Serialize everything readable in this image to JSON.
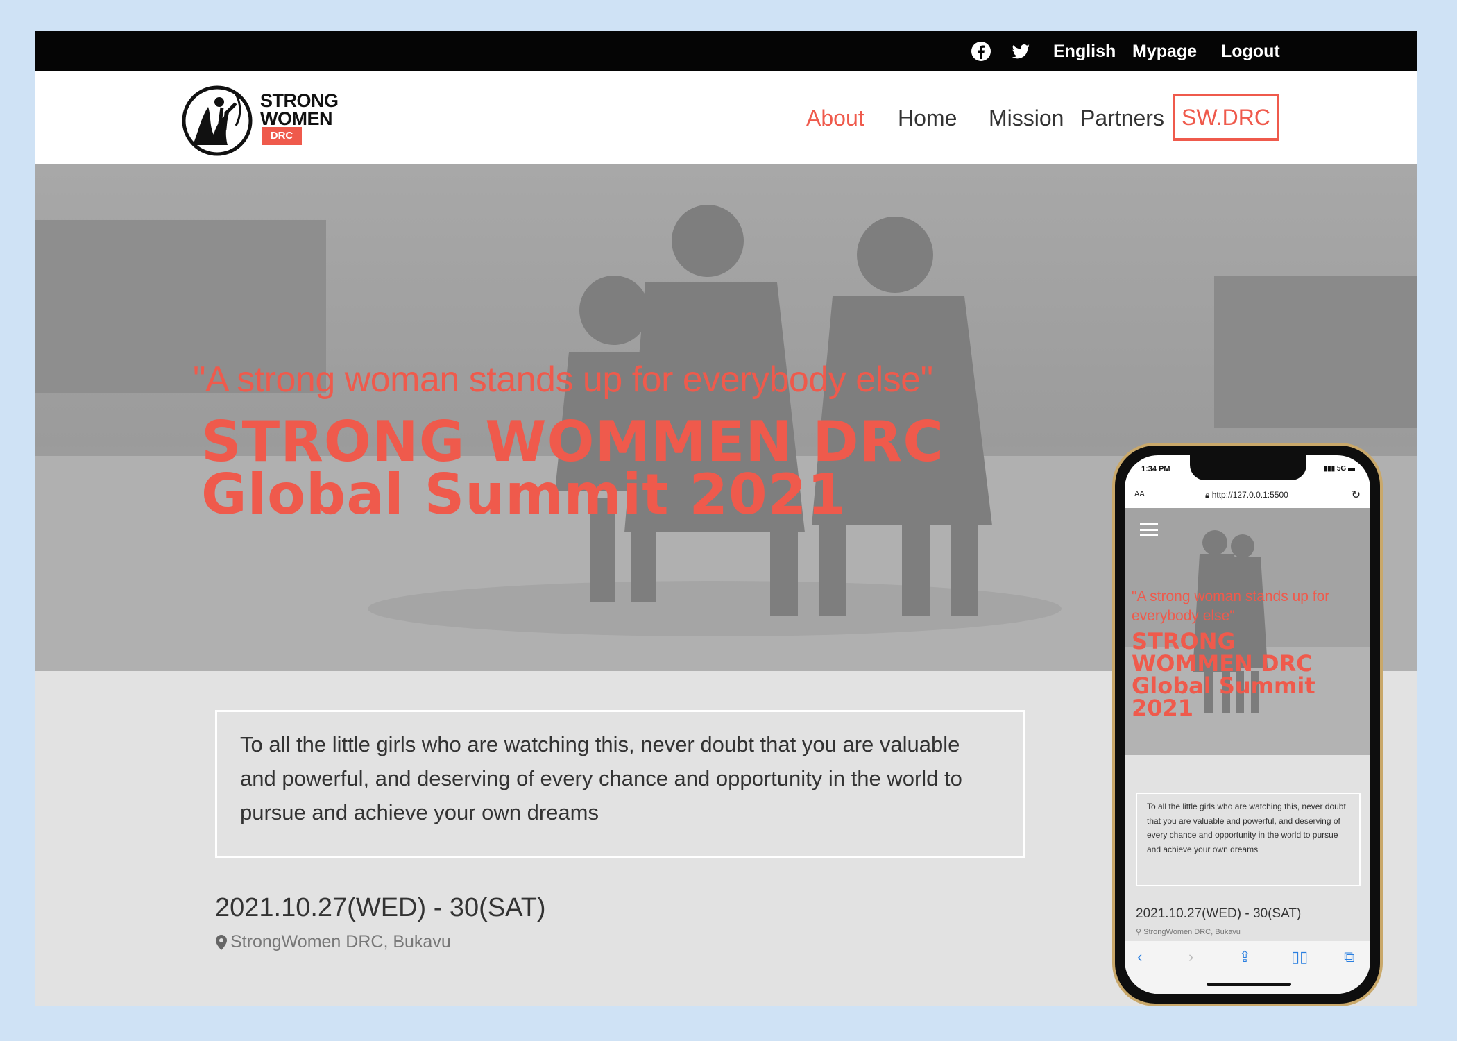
{
  "topbar": {
    "facebook_icon": "facebook-icon",
    "twitter_icon": "twitter-icon",
    "language": "English",
    "mypage": "Mypage",
    "logout": "Logout"
  },
  "logo": {
    "line1": "STRONG",
    "line2": "WOMEN",
    "badge": "DRC"
  },
  "nav": {
    "about": "About",
    "home": "Home",
    "mission": "Mission",
    "partners": "Partners",
    "swdrc": "SW.DRC"
  },
  "hero": {
    "quote": "\"A strong woman stands up for everybody else\"",
    "title_line1": "STRONG WOMMEN DRC",
    "title_line2": "Global Summit 2021"
  },
  "intro": {
    "text": "To all the little girls who are watching this, never doubt that you are valuable and powerful, and deserving of every chance and opportunity in the world to pursue and achieve your own dreams"
  },
  "event": {
    "date": "2021.10.27(WED) - 30(SAT)",
    "location": "StrongWomen DRC, Bukavu"
  },
  "phone": {
    "time": "1:34 PM",
    "signal": "5G",
    "url_aa": "AA",
    "url": "http://127.0.0.1:5500",
    "quote": "\"A strong woman stands up for everybody else\"",
    "title": "STRONG WOMMEN DRC Global Summit 2021",
    "intro": "To all the little girls who are watching this, never doubt that you are valuable and powerful, and deserving of every chance and opportunity in the world to pursue and achieve your own dreams",
    "date": "2021.10.27(WED) - 30(SAT)",
    "location": "StrongWomen DRC, Bukavu"
  },
  "colors": {
    "accent": "#ef5a4c",
    "background": "#cfe2f5",
    "topbar": "#050505"
  }
}
